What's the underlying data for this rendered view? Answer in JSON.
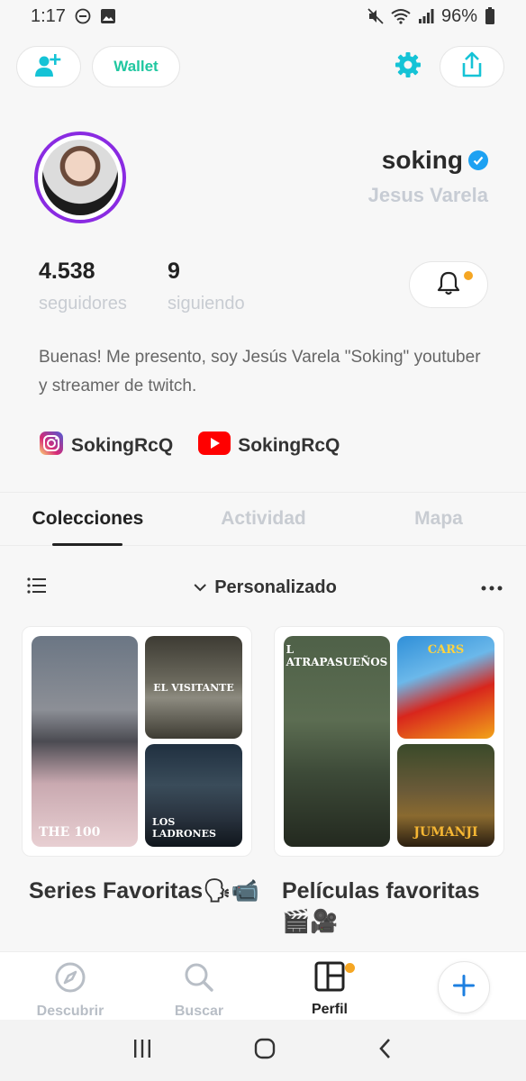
{
  "status_bar": {
    "time": "1:17",
    "battery": "96%"
  },
  "top_actions": {
    "wallet_label": "Wallet"
  },
  "profile": {
    "username": "soking",
    "real_name": "Jesus Varela",
    "followers_count": "4.538",
    "followers_label": "seguidores",
    "following_count": "9",
    "following_label": "siguiendo",
    "bio": "Buenas! Me presento, soy Jesús Varela \"Soking\" youtuber y streamer de twitch.",
    "instagram": "SokingRcQ",
    "youtube": "SokingRcQ"
  },
  "tabs": [
    {
      "label": "Colecciones",
      "active": true
    },
    {
      "label": "Actividad",
      "active": false
    },
    {
      "label": "Mapa",
      "active": false
    }
  ],
  "sort": {
    "label": "Personalizado"
  },
  "collections": [
    {
      "title": "Series Favoritas🗣📹",
      "posters": [
        "THE 100",
        "EL VISITANTE",
        "LOS LADRONES"
      ]
    },
    {
      "title": "Películas favoritas 🎬🎥",
      "posters": [
        "L ATRAPASUEÑOS",
        "CARS",
        "JUMANJI"
      ]
    }
  ],
  "bottom_nav": [
    {
      "label": "Descubrir",
      "icon": "compass-icon"
    },
    {
      "label": "Buscar",
      "icon": "search-icon"
    },
    {
      "label": "Perfil",
      "icon": "profile-grid-icon",
      "active": true
    }
  ],
  "colors": {
    "accent": "#1da1f2",
    "wallet": "#20c7a0",
    "ring": "#8a2be2",
    "notif_dot": "#f5a623"
  }
}
